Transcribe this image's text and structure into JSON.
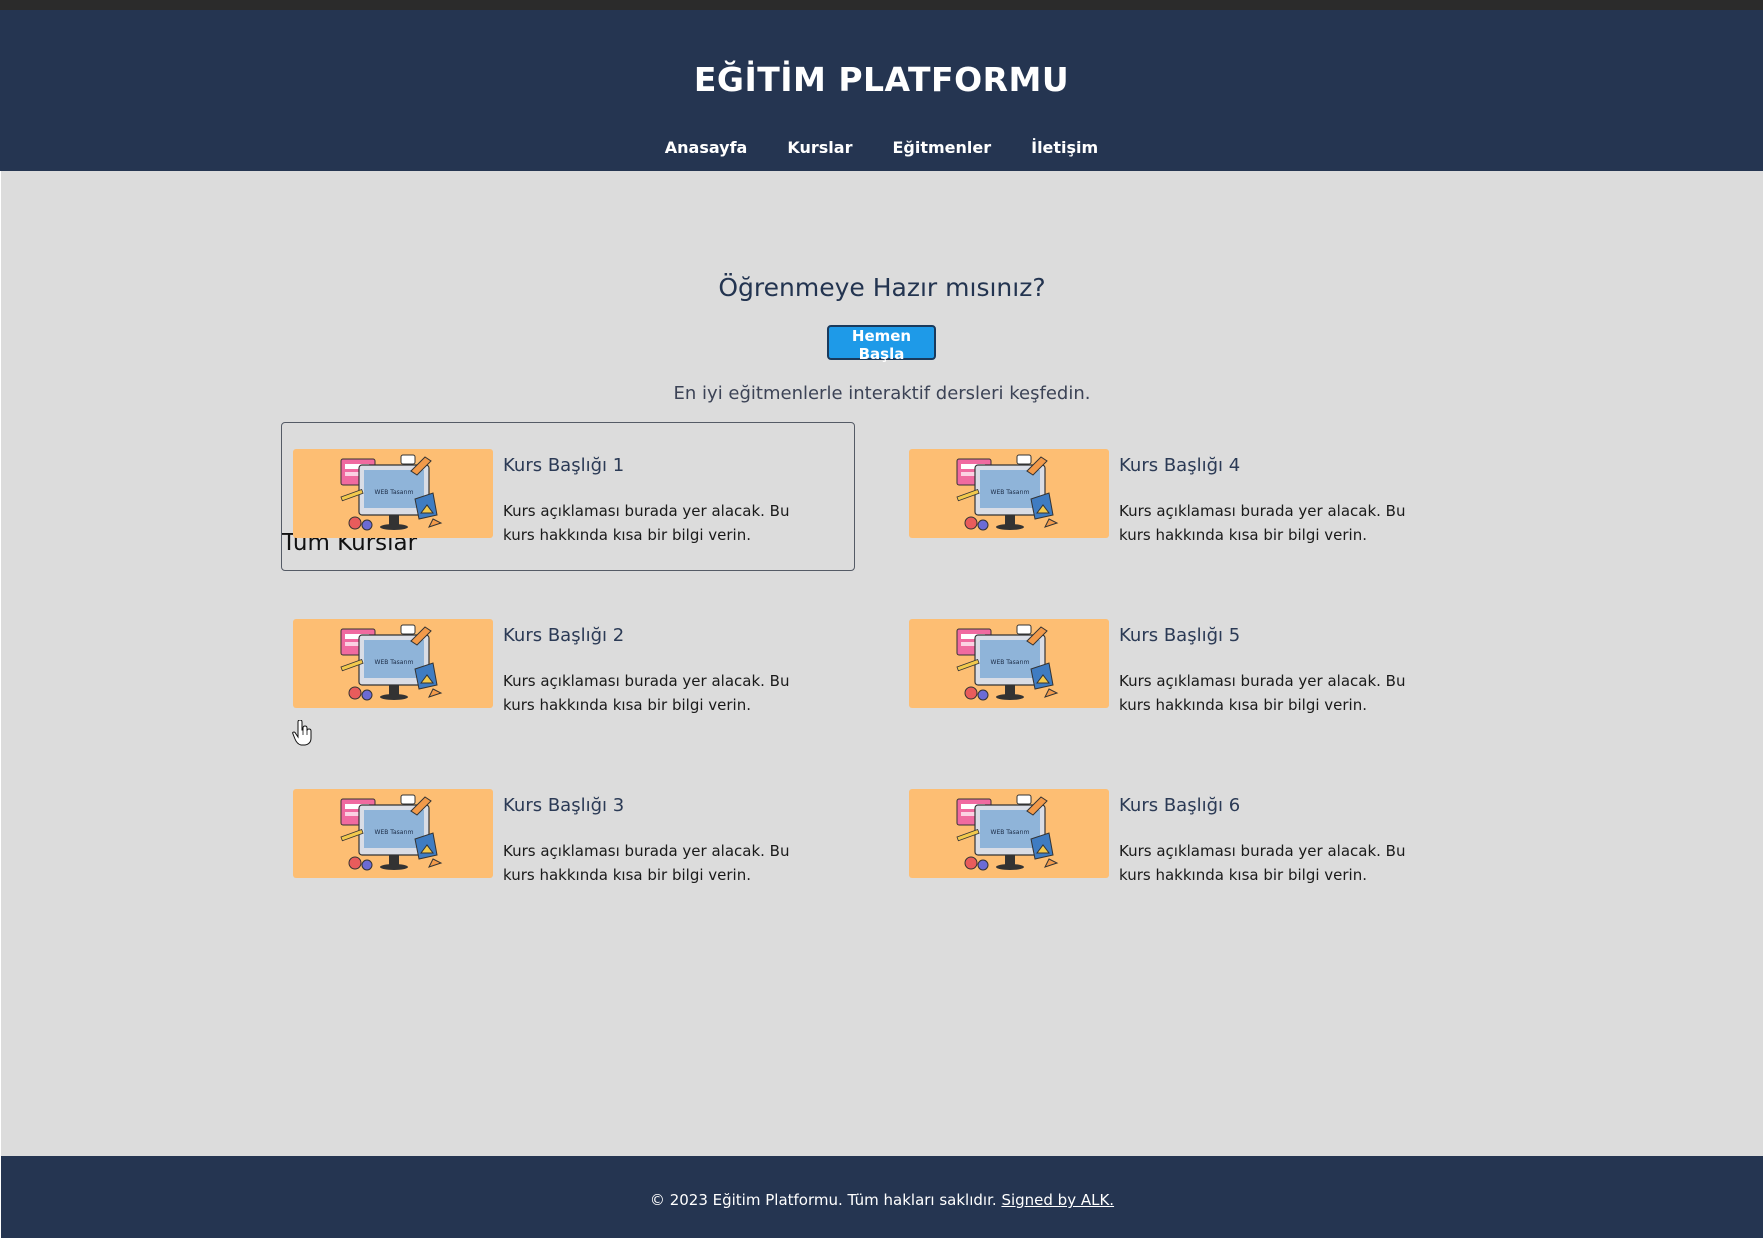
{
  "header": {
    "brand": "EĞİTİM PLATFORMU",
    "nav": [
      "Anasayfa",
      "Kurslar",
      "Eğitmenler",
      "İletişim"
    ]
  },
  "hero": {
    "title": "Öğrenmeye Hazır mısınız?",
    "button": "Hemen Başla",
    "subtitle": "En iyi eğitmenlerle interaktif dersleri keşfedin."
  },
  "courses": {
    "heading": "Tüm Kurslar",
    "image_text": "WEB Tasarım",
    "items": [
      {
        "title": "Kurs Başlığı 1",
        "description": "Kurs açıklaması burada yer alacak. Bu kurs hakkında kısa bir bilgi verin."
      },
      {
        "title": "Kurs Başlığı 4",
        "description": "Kurs açıklaması burada yer alacak. Bu kurs hakkında kısa bir bilgi verin."
      },
      {
        "title": "Kurs Başlığı 2",
        "description": "Kurs açıklaması burada yer alacak. Bu kurs hakkında kısa bir bilgi verin."
      },
      {
        "title": "Kurs Başlığı 5",
        "description": "Kurs açıklaması burada yer alacak. Bu kurs hakkında kısa bir bilgi verin."
      },
      {
        "title": "Kurs Başlığı 3",
        "description": "Kurs açıklaması burada yer alacak. Bu kurs hakkında kısa bir bilgi verin."
      },
      {
        "title": "Kurs Başlığı 6",
        "description": "Kurs açıklaması burada yer alacak. Bu kurs hakkında kısa bir bilgi verin."
      }
    ]
  },
  "footer": {
    "text": "© 2023 Eğitim Platformu. Tüm hakları saklıdır.",
    "link": "Signed by ALK."
  },
  "colors": {
    "header_bg": "#253551",
    "page_bg": "#dcdcdc",
    "accent": "#1e9ae8",
    "thumb_bg": "#fdbe73"
  }
}
